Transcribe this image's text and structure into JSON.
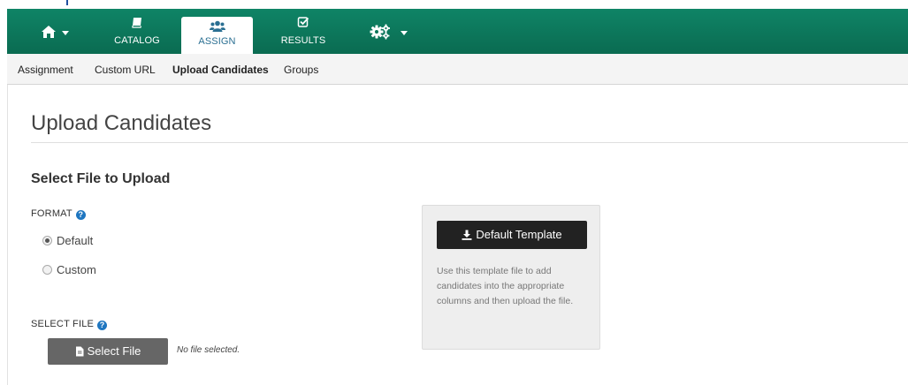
{
  "nav": {
    "items": [
      {
        "id": "home",
        "label": "",
        "icon": "home-icon",
        "has_caret": true
      },
      {
        "id": "catalog",
        "label": "CATALOG",
        "icon": "book-icon"
      },
      {
        "id": "assign",
        "label": "ASSIGN",
        "icon": "users-icon",
        "active": true
      },
      {
        "id": "results",
        "label": "RESULTS",
        "icon": "checkbox-icon"
      },
      {
        "id": "settings",
        "label": "",
        "icon": "gears-icon",
        "has_caret": true
      }
    ],
    "colors": {
      "bar": "#0a6b51",
      "active_text": "#2a6f92"
    }
  },
  "subnav": {
    "items": [
      {
        "label": "Assignment"
      },
      {
        "label": "Custom URL"
      },
      {
        "label": "Upload Candidates",
        "active": true
      },
      {
        "label": "Groups"
      }
    ]
  },
  "page": {
    "title": "Upload Candidates",
    "section_title": "Select File to Upload",
    "format_label": "FORMAT",
    "format_options": [
      {
        "label": "Default",
        "checked": true
      },
      {
        "label": "Custom",
        "checked": false
      }
    ],
    "select_file_label": "SELECT FILE",
    "select_file_button": "Select File",
    "file_status": "No file selected."
  },
  "template": {
    "button_label": "Default Template",
    "description": "Use this template file to add candidates into the appropriate columns and then upload the file."
  }
}
